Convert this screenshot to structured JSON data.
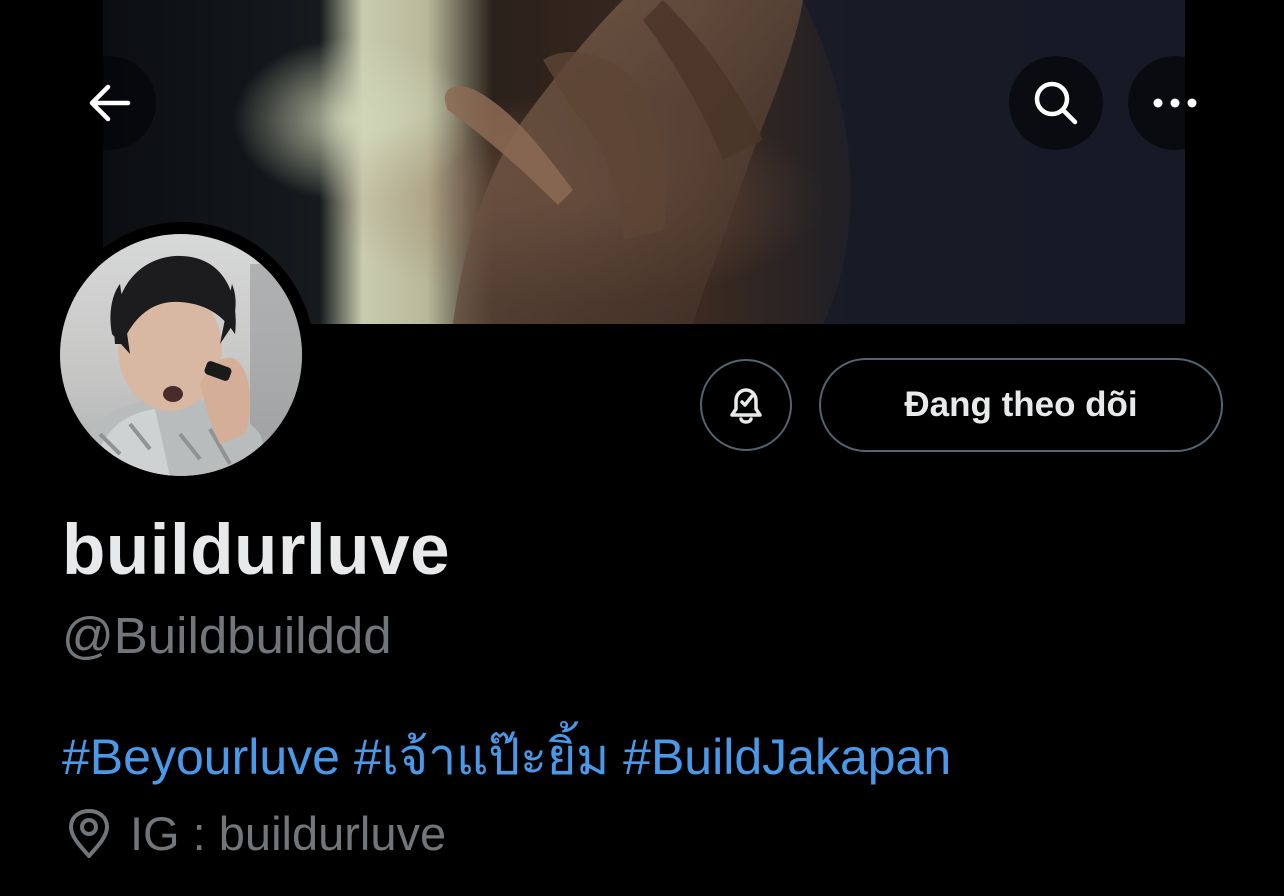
{
  "header": {
    "back_icon": "arrow-left-icon",
    "search_icon": "search-icon",
    "more_icon": "more-horizontal-icon"
  },
  "profile": {
    "display_name": "buildurluve",
    "handle": "@Buildbuilddd",
    "follow_button_label": "Đang theo dõi",
    "notification_icon": "bell-check-icon",
    "bio_tags": [
      "#Beyourluve",
      "#เจ้าแป๊ะยิ้ม",
      "#BuildJakapan"
    ],
    "location_icon": "location-pin-icon",
    "location": "IG : buildurluve"
  },
  "colors": {
    "background": "#000000",
    "text_primary": "#e7e9ea",
    "text_secondary": "#71767b",
    "link": "#4a99e9",
    "border": "#536471"
  }
}
